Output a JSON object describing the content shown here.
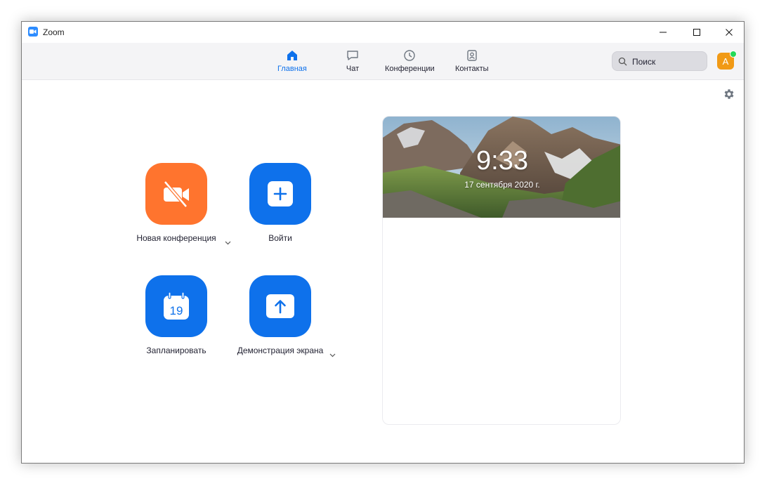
{
  "window": {
    "title": "Zoom",
    "controls": [
      "minimize-icon",
      "maximize-icon",
      "close-icon"
    ]
  },
  "nav": {
    "tabs": [
      {
        "label": "Главная",
        "icon": "home-icon",
        "active": true
      },
      {
        "label": "Чат",
        "icon": "chat-icon",
        "active": false
      },
      {
        "label": "Конференции",
        "icon": "clock-icon",
        "active": false
      },
      {
        "label": "Контакты",
        "icon": "contacts-icon",
        "active": false
      }
    ],
    "search": {
      "placeholder": "Поиск",
      "value": ""
    },
    "avatar": {
      "initial": "A",
      "color": "#f19a16",
      "status_color": "#23d959"
    }
  },
  "actions": [
    {
      "label": "Новая конференция",
      "icon": "video-off-icon",
      "color": "#ff742e",
      "has_dropdown": true
    },
    {
      "label": "Войти",
      "icon": "plus-icon",
      "color": "#0e71eb",
      "has_dropdown": false
    },
    {
      "label": "Запланировать",
      "icon": "calendar-icon",
      "color": "#0e71eb",
      "has_dropdown": false,
      "calendar_day": "19"
    },
    {
      "label": "Демонстрация экрана",
      "icon": "share-screen-icon",
      "color": "#0e71eb",
      "has_dropdown": true
    }
  ],
  "panel": {
    "time": "9:33",
    "date": "17 сентября 2020 г."
  },
  "colors": {
    "accent": "#0e71eb",
    "orange": "#ff742e"
  }
}
